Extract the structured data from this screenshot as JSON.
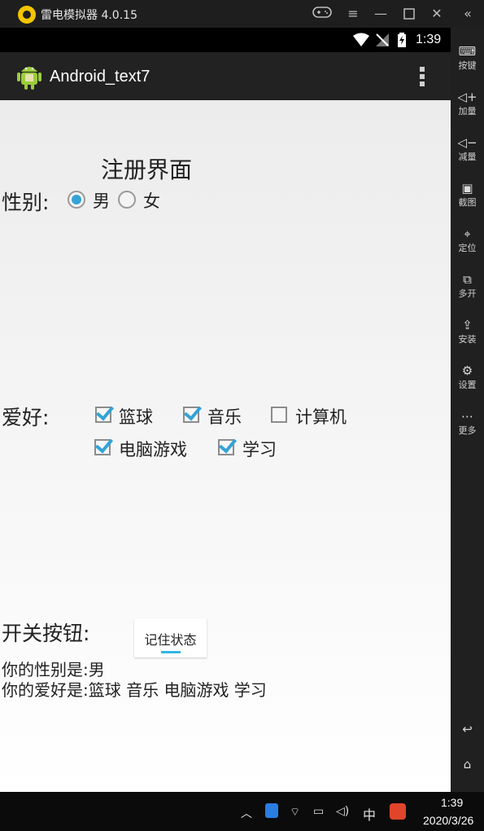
{
  "emulator": {
    "title": "雷电模拟器 4.0.15",
    "side_items": [
      "按键",
      "加量",
      "减量",
      "截图",
      "定位",
      "多开",
      "安装",
      "设置",
      "更多"
    ]
  },
  "status_bar": {
    "time": "1:39"
  },
  "action_bar": {
    "title": "Android_text7"
  },
  "form": {
    "heading": "注册界面",
    "gender_label": "性别:",
    "gender_options": [
      "男",
      "女"
    ],
    "gender_selected": "男",
    "hobby_label": "爱好:",
    "hobbies": [
      {
        "label": "篮球",
        "checked": true
      },
      {
        "label": "音乐",
        "checked": true
      },
      {
        "label": "计算机",
        "checked": false
      },
      {
        "label": "电脑游戏",
        "checked": true
      },
      {
        "label": "学习",
        "checked": true
      }
    ],
    "switch_label": "开关按钮:",
    "toggle_text": "记住状态",
    "result_gender": "你的性别是:男",
    "result_hobby": "你的爱好是:篮球 音乐 电脑游戏 学习"
  },
  "taskbar": {
    "ime": "中",
    "time": "1:39",
    "date": "2020/3/26"
  },
  "colors": {
    "accent": "#33a3d6",
    "action_bar": "#222222"
  }
}
